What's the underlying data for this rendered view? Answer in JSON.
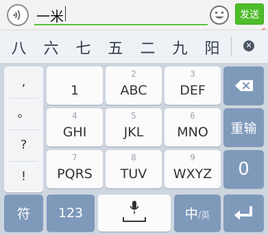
{
  "input": {
    "text": "一米",
    "send_label": "发送"
  },
  "candidates": [
    "八",
    "六",
    "七",
    "五",
    "二",
    "九",
    "阳"
  ],
  "keyboard": {
    "punctuation": [
      ",",
      "。",
      "?",
      "!"
    ],
    "keys": [
      {
        "num": "",
        "letters": "1"
      },
      {
        "num": "2",
        "letters": "ABC"
      },
      {
        "num": "3",
        "letters": "DEF"
      },
      {
        "num": "4",
        "letters": "GHI"
      },
      {
        "num": "5",
        "letters": "JKL"
      },
      {
        "num": "6",
        "letters": "MNO"
      },
      {
        "num": "7",
        "letters": "PQRS"
      },
      {
        "num": "8",
        "letters": "TUV"
      },
      {
        "num": "9",
        "letters": "WXYZ"
      }
    ],
    "reinput_label": "重输",
    "zero_label": "0",
    "symbol_label": "符",
    "numeric_label": "123",
    "lang_main": "中",
    "lang_alt": "/英"
  },
  "colors": {
    "send": "#4ebd2b",
    "accent_underline": "#59c33a",
    "function_key": "#7f99bb",
    "keyboard_bg": "#cdd5df"
  }
}
